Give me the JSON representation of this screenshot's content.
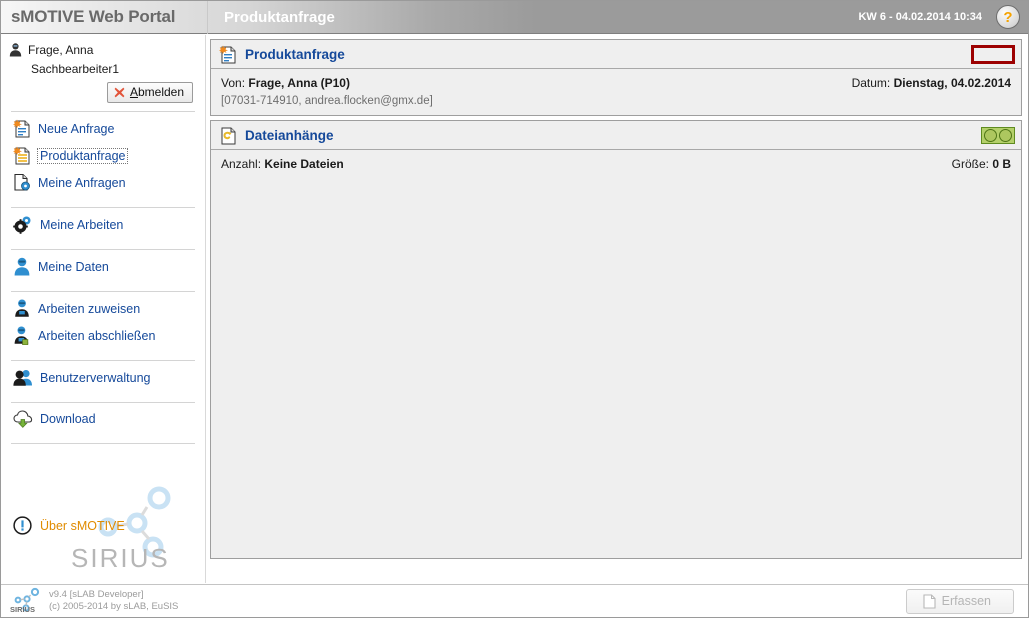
{
  "topbar": {
    "brand": "sMOTIVE Web Portal",
    "page_title": "Produktanfrage",
    "kw_stamp": "KW 6 - 04.02.2014 10:34",
    "help_glyph": "?"
  },
  "sidebar": {
    "user_name": "Frage, Anna",
    "user_role": "Sachbearbeiter1",
    "logout_label_pre": "",
    "logout_label_a": "A",
    "logout_label_rest": "bmelden",
    "nav_groups": [
      {
        "items": [
          {
            "label": "Neue Anfrage",
            "icon": "new-document-icon",
            "selected": false
          },
          {
            "label": "Produktanfrage",
            "icon": "product-request-icon",
            "selected": true
          },
          {
            "label": "Meine Anfragen",
            "icon": "my-requests-icon",
            "selected": false
          }
        ]
      },
      {
        "items": [
          {
            "label": "Meine Arbeiten",
            "icon": "gears-icon",
            "selected": false
          }
        ]
      },
      {
        "items": [
          {
            "label": "Meine Daten",
            "icon": "user-data-icon",
            "selected": false
          }
        ]
      },
      {
        "items": [
          {
            "label": "Arbeiten zuweisen",
            "icon": "assign-work-icon",
            "selected": false
          },
          {
            "label": "Arbeiten abschließen",
            "icon": "complete-work-icon",
            "selected": false
          }
        ]
      },
      {
        "items": [
          {
            "label": "Benutzerverwaltung",
            "icon": "users-admin-icon",
            "selected": false
          }
        ]
      },
      {
        "items": [
          {
            "label": "Download",
            "icon": "download-cloud-icon",
            "selected": false
          }
        ]
      }
    ],
    "about_label": "Über sMOTIVE",
    "watermark_text": "SIRIUS"
  },
  "content": {
    "request_panel": {
      "title": "Produktanfrage",
      "from_label": "Von:",
      "from_value": "Frage, Anna (P10)",
      "date_label": "Datum:",
      "date_value": "Dienstag, 04.02.2014",
      "contact": "[07031-714910, andrea.flocken@gmx.de]"
    },
    "attachments_panel": {
      "title": "Dateianhänge",
      "count_label": "Anzahl:",
      "count_value": "Keine Dateien",
      "size_label": "Größe:",
      "size_value": "0 B"
    }
  },
  "footer": {
    "version": "v9.4 [sLAB Developer]",
    "copyright": "(c) 2005-2014 by sLAB, EuSIS",
    "submit_label": "Erfassen"
  },
  "colors": {
    "link_blue": "#15499a",
    "accent_orange": "#e08b00",
    "highlight_red": "#9c0000",
    "toggle_green": "#adc75f",
    "header_grey": "#9b9b9b"
  }
}
